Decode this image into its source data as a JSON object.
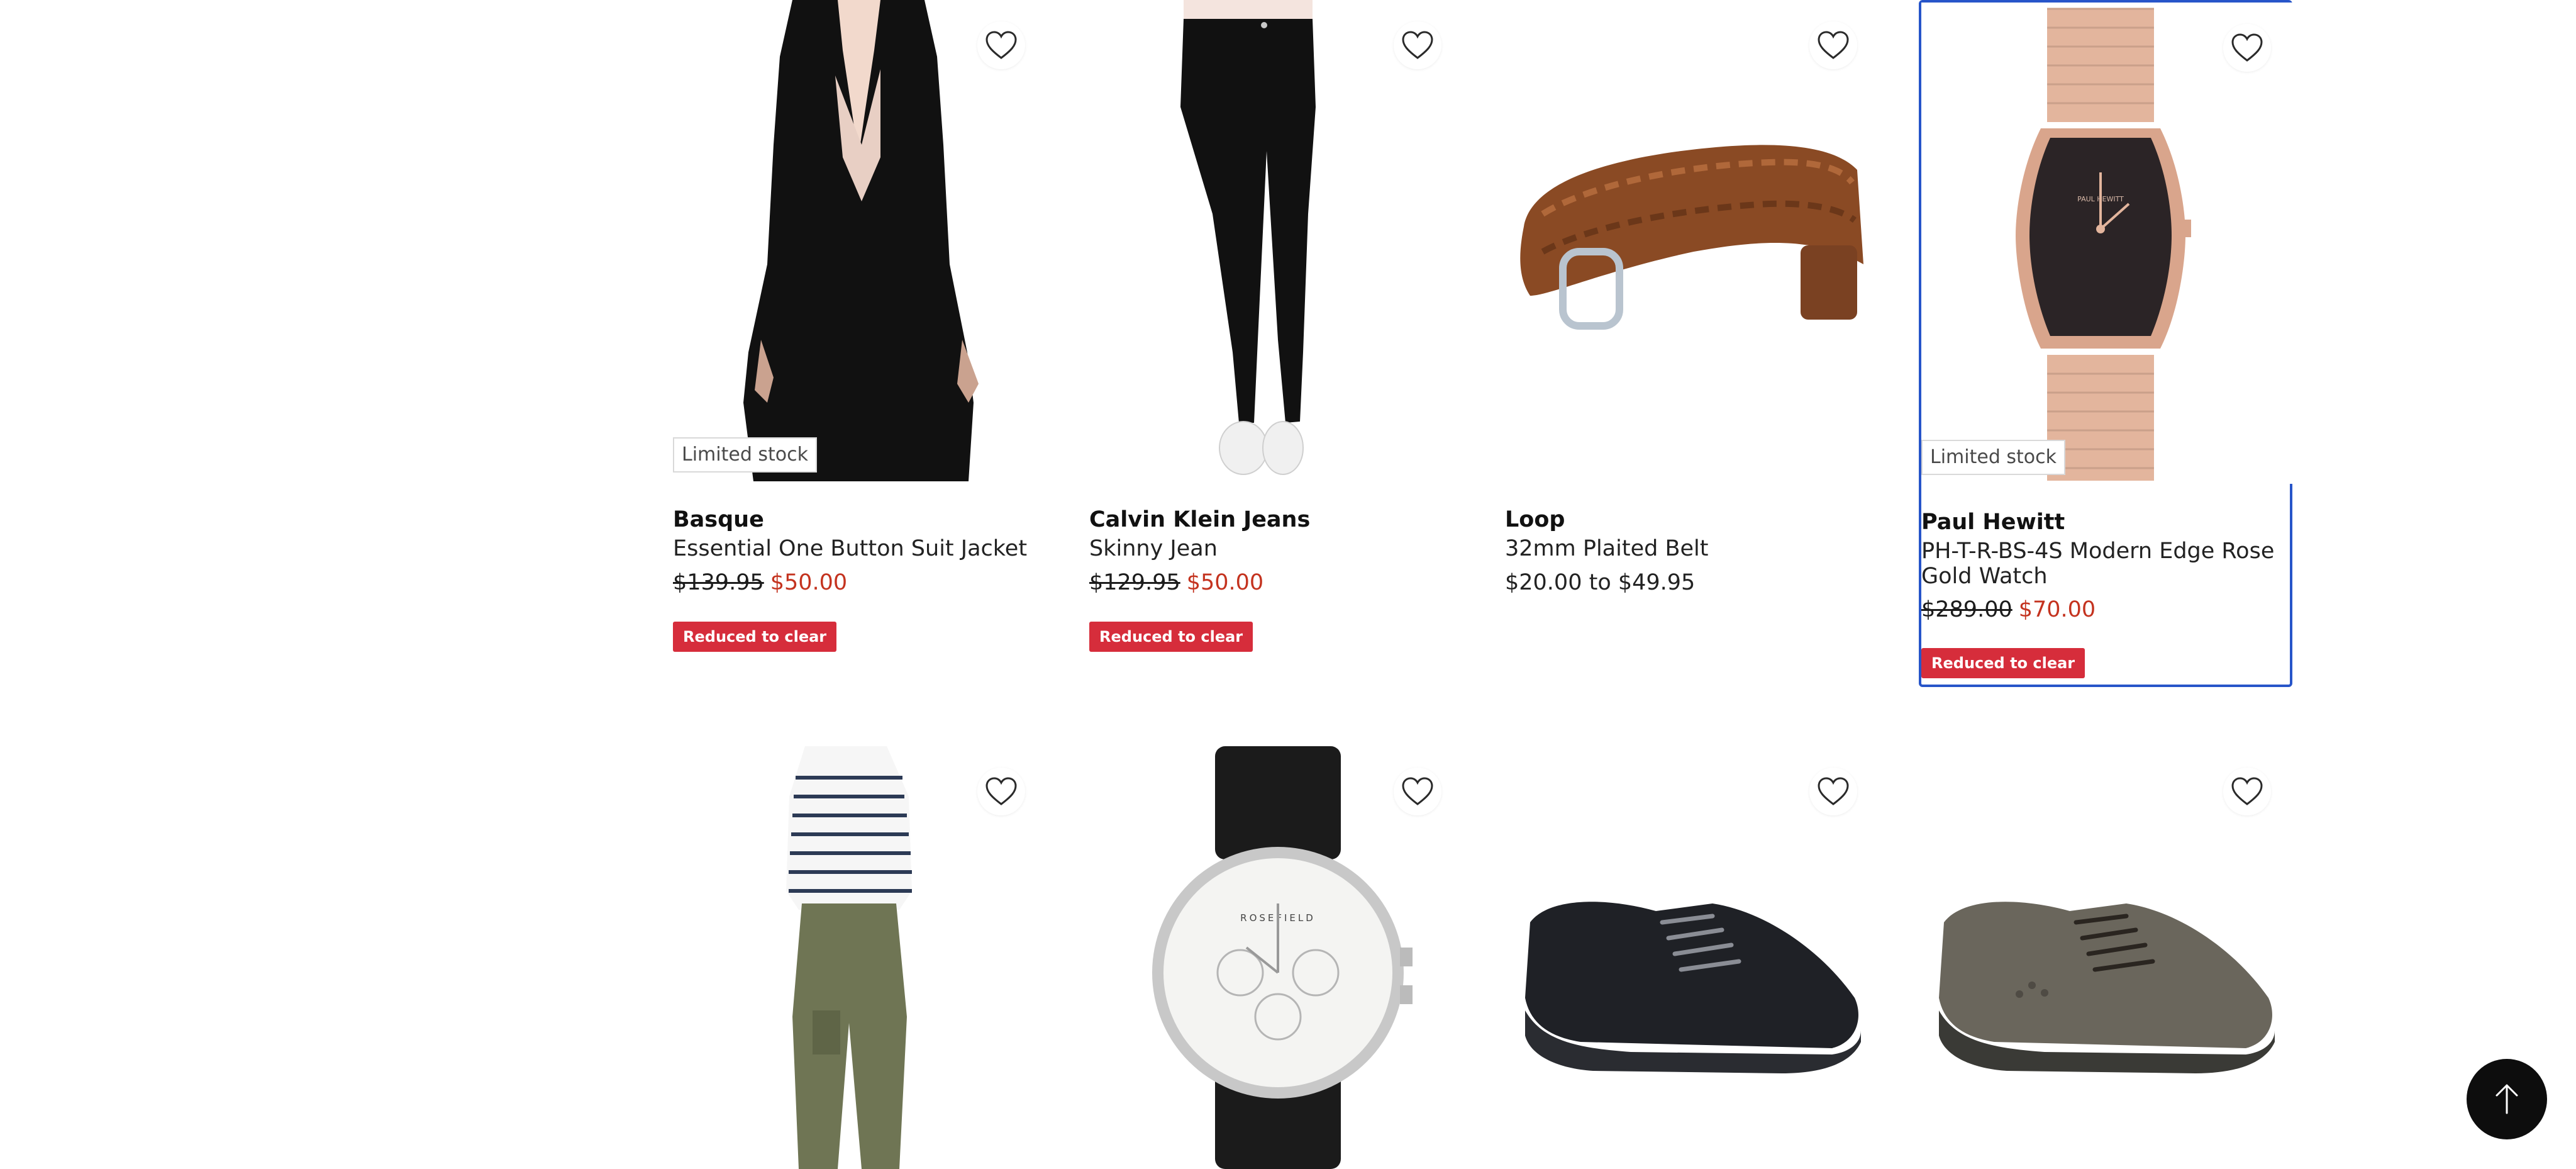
{
  "products": [
    {
      "brand": "Basque",
      "name": "Essential One Button Suit Jacket",
      "was": "$139.95",
      "now": "$50.00",
      "stock": "Limited stock",
      "badge": "Reduced to clear",
      "image": "black-suit-jacket"
    },
    {
      "brand": "Calvin Klein Jeans",
      "name": "Skinny Jean",
      "was": "$129.95",
      "now": "$50.00",
      "badge": "Reduced to clear",
      "image": "black-skinny-jeans"
    },
    {
      "brand": "Loop",
      "name": "32mm Plaited Belt",
      "price": "$20.00 to $49.95",
      "image": "brown-plaited-belt"
    },
    {
      "brand": "Paul Hewitt",
      "name": "PH-T-R-BS-4S Modern Edge Rose Gold Watch",
      "was": "$289.00",
      "now": "$70.00",
      "stock": "Limited stock",
      "badge": "Reduced to clear",
      "image": "rose-gold-watch"
    },
    {
      "image": "striped-top-cargo-pants"
    },
    {
      "image": "black-strap-watch",
      "watch_brand": "ROSEFIELD"
    },
    {
      "image": "black-sneaker"
    },
    {
      "image": "grey-sneaker"
    }
  ],
  "icons": {
    "wishlist": "heart-outline-icon",
    "back_to_top": "arrow-up-icon"
  },
  "colors": {
    "sale_price": "#c4331f",
    "badge_bg": "#d62d3b",
    "focus_border": "#2755c9"
  }
}
